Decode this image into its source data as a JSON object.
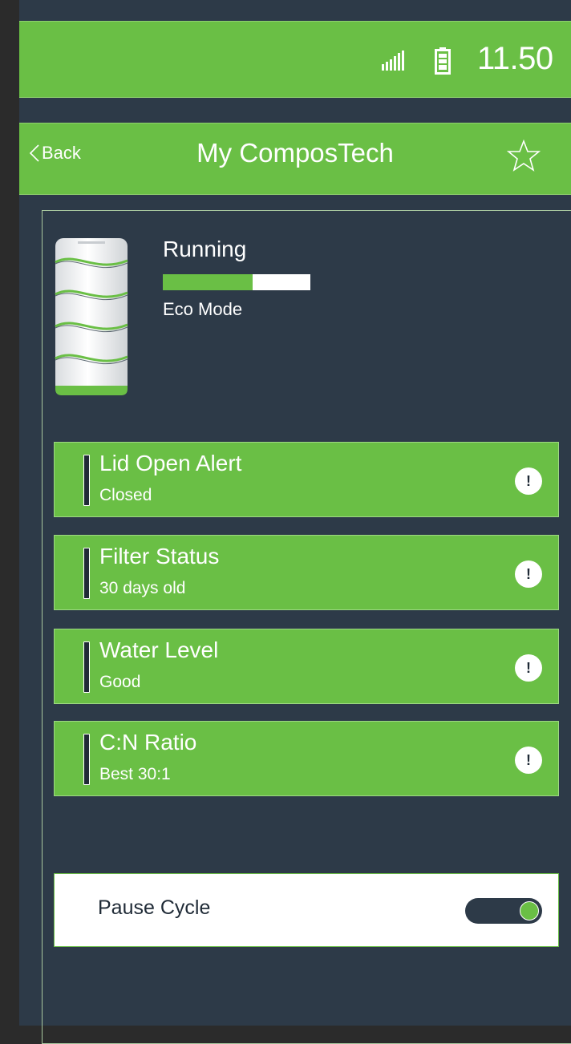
{
  "status_bar": {
    "time": "11.50",
    "signal_icon": "signal-icon",
    "battery_icon": "battery-icon"
  },
  "app_bar": {
    "back_label": "Back",
    "title": "My ComposTech",
    "favorite_icon": "star-icon"
  },
  "device": {
    "image": "composter-device-illustration",
    "state": "Running",
    "progress_percent": 61,
    "mode": "Eco Mode"
  },
  "tiles": [
    {
      "title": "Lid Open Alert",
      "subtitle": "Closed",
      "alert_glyph": "!"
    },
    {
      "title": "Filter Status",
      "subtitle": "30 days old",
      "alert_glyph": "!"
    },
    {
      "title": "Water Level",
      "subtitle": "Good",
      "alert_glyph": "!"
    },
    {
      "title": "C:N Ratio",
      "subtitle": "Best 30:1",
      "alert_glyph": "!"
    }
  ],
  "pause_cycle": {
    "label": "Pause Cycle",
    "on": true
  },
  "colors": {
    "brand_green": "#6abf45",
    "background": "#2d3a48",
    "outer": "#2b2b2b"
  }
}
